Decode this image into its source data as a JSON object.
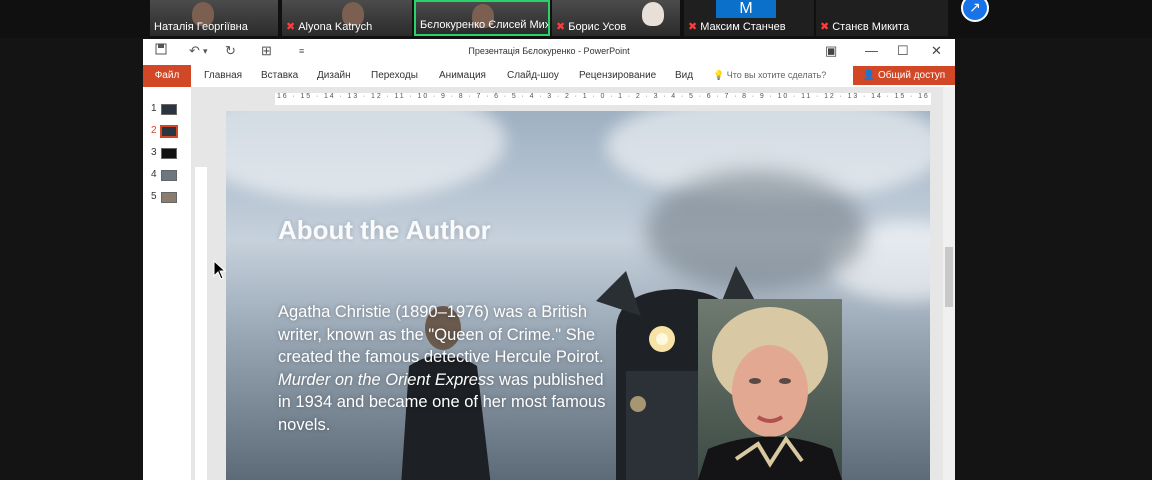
{
  "participants": [
    {
      "name": "Наталія Георгіївна",
      "muted": false,
      "active": false
    },
    {
      "name": "Alyona Katrych",
      "muted": true,
      "active": false
    },
    {
      "name": "Бєлокуренко Єлисей Мих...",
      "muted": false,
      "active": true
    },
    {
      "name": "Борис Усов",
      "muted": true,
      "active": false
    },
    {
      "name": "Максим Станчев",
      "muted": true,
      "active": false,
      "logo": "M"
    },
    {
      "name": "Станєв Микита",
      "muted": true,
      "active": false
    }
  ],
  "powerpoint": {
    "window_title": "Презентація Бєлокуренко - PowerPoint",
    "file_tab": "Файл",
    "menu": [
      "Главная",
      "Вставка",
      "Дизайн",
      "Переходы",
      "Анимация",
      "Слайд-шоу",
      "Рецензирование",
      "Вид"
    ],
    "tell_me": "Что вы хотите сделать?",
    "share": "Общий доступ",
    "slides": [
      "1",
      "2",
      "3",
      "4",
      "5"
    ],
    "selected_slide": 2,
    "ruler_h": "16 · 15 · 14 · 13 · 12 · 11 · 10 · 9 · 8 · 7 · 6 · 5 · 4 · 3 · 2 · 1 · 0 · 1 · 2 · 3 · 4 · 5 · 6 · 7 · 8 · 9 · 10 · 11 · 12 · 13 · 14 · 15 · 16",
    "slide": {
      "title": "About the Author",
      "body_1": "Agatha Christie (1890–1976) was a British writer, known as the \"Queen of Crime.\" She created the famous detective Hercule Poirot. ",
      "body_italic": "Murder on the Orient Express",
      "body_2": " was published in 1934 and became one of her most famous novels."
    }
  },
  "icons": {
    "save": "save-icon",
    "undo": "undo-icon",
    "redo": "redo-icon",
    "present": "present-icon"
  }
}
